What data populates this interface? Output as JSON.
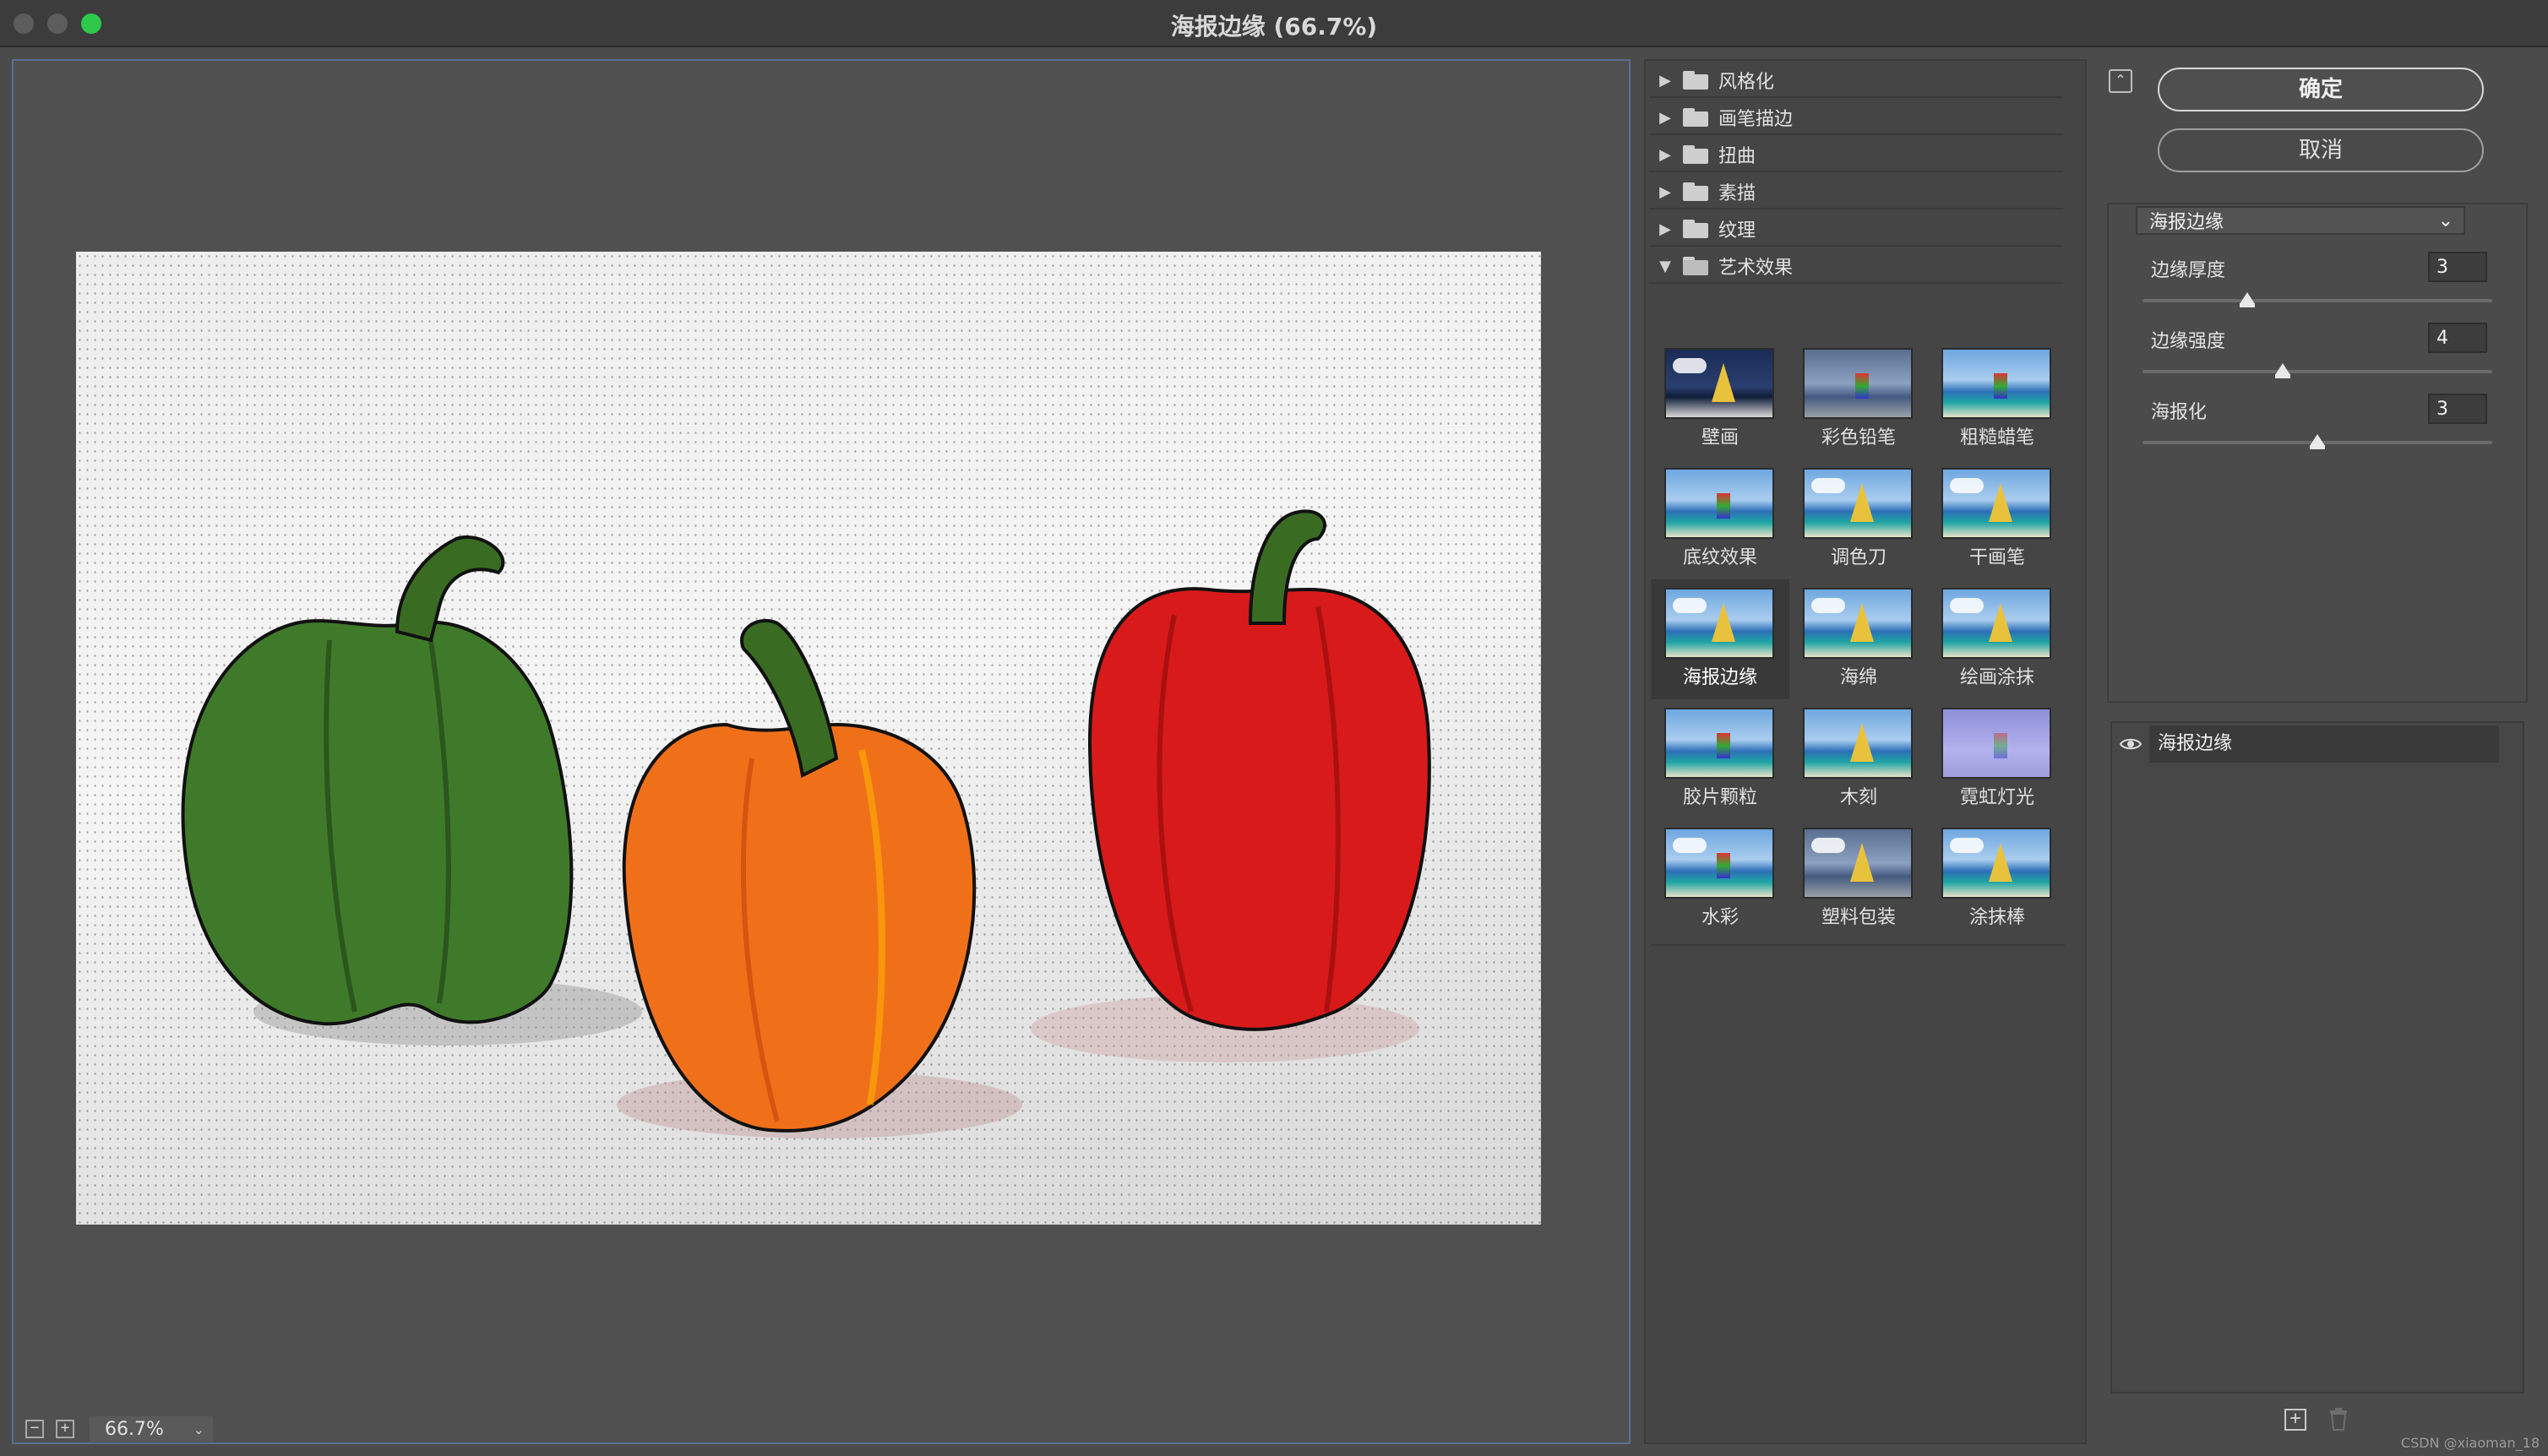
{
  "window": {
    "title": "海报边缘 (66.7%)"
  },
  "preview": {
    "zoom": "66.7%"
  },
  "categories": [
    {
      "label": "风格化",
      "expanded": false
    },
    {
      "label": "画笔描边",
      "expanded": false
    },
    {
      "label": "扭曲",
      "expanded": false
    },
    {
      "label": "素描",
      "expanded": false
    },
    {
      "label": "纹理",
      "expanded": false
    },
    {
      "label": "艺术效果",
      "expanded": true
    }
  ],
  "artistic_filters": [
    {
      "label": "壁画"
    },
    {
      "label": "彩色铅笔"
    },
    {
      "label": "粗糙蜡笔"
    },
    {
      "label": "底纹效果"
    },
    {
      "label": "调色刀"
    },
    {
      "label": "干画笔"
    },
    {
      "label": "海报边缘",
      "selected": true
    },
    {
      "label": "海绵"
    },
    {
      "label": "绘画涂抹"
    },
    {
      "label": "胶片颗粒"
    },
    {
      "label": "木刻"
    },
    {
      "label": "霓虹灯光"
    },
    {
      "label": "水彩"
    },
    {
      "label": "塑料包装"
    },
    {
      "label": "涂抹棒"
    }
  ],
  "buttons": {
    "ok": "确定",
    "cancel": "取消"
  },
  "settings": {
    "filter_selected": "海报边缘",
    "params": [
      {
        "label": "边缘厚度",
        "value": "3",
        "fraction": 0.3
      },
      {
        "label": "边缘强度",
        "value": "4",
        "fraction": 0.4
      },
      {
        "label": "海报化",
        "value": "3",
        "fraction": 0.5
      }
    ]
  },
  "layers": [
    {
      "name": "海报边缘"
    }
  ],
  "watermark": "CSDN @xiaoman_18",
  "colors": {
    "accent_max": "#2ec94a",
    "window_bg": "#4b4b4b"
  }
}
